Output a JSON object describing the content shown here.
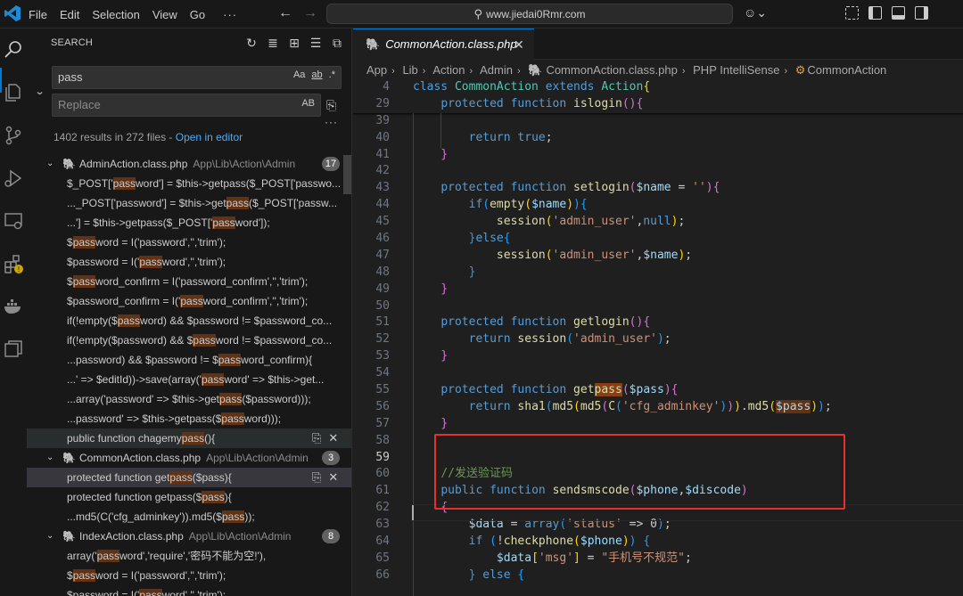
{
  "titlebar": {
    "menus": [
      "File",
      "Edit",
      "Selection",
      "View",
      "Go"
    ],
    "more": "···",
    "address": "www.jiedai0Rmr.com"
  },
  "sidebar": {
    "title": "SEARCH",
    "search_value": "pass",
    "replace_placeholder": "Replace",
    "opt_case": "Aa",
    "opt_word": "ab",
    "opt_regex": ".*",
    "opt_preserve": "AB",
    "summary": "1402 results in 272 files - ",
    "open_in_editor": "Open in editor",
    "results": [
      {
        "kind": "file",
        "name": "AdminAction.class.php",
        "path": "App\\Lib\\Action\\Admin",
        "count": "17"
      },
      {
        "kind": "match",
        "pre": "$_POST['",
        "hit": "pass",
        "post": "word'] = $this->getpass($_POST['passwo..."
      },
      {
        "kind": "match",
        "pre": "..._POST['password'] = $this->get",
        "hit": "pass",
        "post": "($_POST['passw..."
      },
      {
        "kind": "match",
        "pre": "...'] = $this->getpass($_POST['",
        "hit": "pass",
        "post": "word']);"
      },
      {
        "kind": "match",
        "pre": "$",
        "hit": "pass",
        "post": "word = I('password','','trim');"
      },
      {
        "kind": "match",
        "pre": "$password = I('",
        "hit": "pass",
        "post": "word','','trim');"
      },
      {
        "kind": "match",
        "pre": "$",
        "hit": "pass",
        "post": "word_confirm = I('password_confirm','','trim');"
      },
      {
        "kind": "match",
        "pre": "$password_confirm = I('",
        "hit": "pass",
        "post": "word_confirm','','trim');"
      },
      {
        "kind": "match",
        "pre": "if(!empty($",
        "hit": "pass",
        "post": "word) && $password != $password_co..."
      },
      {
        "kind": "match",
        "pre": "if(!empty($password) && $",
        "hit": "pass",
        "post": "word != $password_co..."
      },
      {
        "kind": "match",
        "pre": "...password) && $password != $",
        "hit": "pass",
        "post": "word_confirm){"
      },
      {
        "kind": "match",
        "pre": "...' => $editId))->save(array('",
        "hit": "pass",
        "post": "word' => $this->get..."
      },
      {
        "kind": "match",
        "pre": "...array('password' => $this->get",
        "hit": "pass",
        "post": "($password)));"
      },
      {
        "kind": "match",
        "pre": "...password' => $this->getpass($",
        "hit": "pass",
        "post": "word)));"
      },
      {
        "kind": "match",
        "pre": "public function chagemy",
        "hit": "pass",
        "post": "(){",
        "focus": true
      },
      {
        "kind": "file",
        "name": "CommonAction.class.php",
        "path": "App\\Lib\\Action\\Admin",
        "count": "3"
      },
      {
        "kind": "match",
        "pre": "protected function get",
        "hit": "pass",
        "post": "($pass){",
        "selected": true
      },
      {
        "kind": "match",
        "pre": "protected function getpass($",
        "hit": "pass",
        "post": "){"
      },
      {
        "kind": "match",
        "pre": "...md5(C('cfg_adminkey')).md5($",
        "hit": "pass",
        "post": "));"
      },
      {
        "kind": "file",
        "name": "IndexAction.class.php",
        "path": "App\\Lib\\Action\\Admin",
        "count": "8"
      },
      {
        "kind": "match",
        "pre": "array('",
        "hit": "pass",
        "post": "word','require','密码不能为空!'),"
      },
      {
        "kind": "match",
        "pre": "$",
        "hit": "pass",
        "post": "word = I('password','','trim');"
      },
      {
        "kind": "match",
        "pre": "$password = I('",
        "hit": "pass",
        "post": "word','','trim');"
      }
    ]
  },
  "editor": {
    "tab_label": "CommonAction.class.php",
    "breadcrumb": [
      "App",
      "Lib",
      "Action",
      "Admin",
      "CommonAction.class.php",
      "PHP IntelliSense",
      "CommonAction"
    ],
    "sticky": [
      {
        "ln": "4",
        "html": "<span class='k'>class</span> <span class='t'>CommonAction</span> <span class='k'>extends</span> <span class='t'>Action</span><span class='b'>{</span>"
      },
      {
        "ln": "29",
        "html": "    <span class='k'>protected</span> <span class='k'>function</span> <span class='f'>islogin</span><span class='b2'>()</span><span class='b2'>{</span>"
      }
    ],
    "lines": [
      {
        "ln": "39",
        "html": ""
      },
      {
        "ln": "40",
        "html": "        <span class='k'>return</span> <span class='k'>true</span>;"
      },
      {
        "ln": "41",
        "html": "    <span class='b2'>}</span>"
      },
      {
        "ln": "42",
        "html": ""
      },
      {
        "ln": "43",
        "html": "    <span class='k'>protected</span> <span class='k'>function</span> <span class='f'>setlogin</span><span class='b2'>(</span><span class='v'>$name</span> = <span class='s'>''</span><span class='b2'>)</span><span class='b2'>{</span>"
      },
      {
        "ln": "44",
        "html": "        <span class='k'>if</span><span class='b3'>(</span><span class='f'>empty</span><span class='b'>(</span><span class='v'>$name</span><span class='b'>)</span><span class='b3'>)</span><span class='b3'>{</span>"
      },
      {
        "ln": "45",
        "html": "            <span class='f'>session</span><span class='b'>(</span><span class='s'>'admin_user'</span>,<span class='k'>null</span><span class='b'>)</span>;"
      },
      {
        "ln": "46",
        "html": "        <span class='b3'>}</span><span class='k'>else</span><span class='b3'>{</span>"
      },
      {
        "ln": "47",
        "html": "            <span class='f'>session</span><span class='b'>(</span><span class='s'>'admin_user'</span>,<span class='v'>$name</span><span class='b'>)</span>;"
      },
      {
        "ln": "48",
        "html": "        <span class='b3'>}</span>"
      },
      {
        "ln": "49",
        "html": "    <span class='b2'>}</span>"
      },
      {
        "ln": "50",
        "html": ""
      },
      {
        "ln": "51",
        "html": "    <span class='k'>protected</span> <span class='k'>function</span> <span class='f'>getlogin</span><span class='b2'>()</span><span class='b2'>{</span>"
      },
      {
        "ln": "52",
        "html": "        <span class='k'>return</span> <span class='f'>session</span><span class='b3'>(</span><span class='s'>'admin_user'</span><span class='b3'>)</span>;"
      },
      {
        "ln": "53",
        "html": "    <span class='b2'>}</span>"
      },
      {
        "ln": "54",
        "html": ""
      },
      {
        "ln": "55",
        "html": "    <span class='k'>protected</span> <span class='k'>function</span> <span class='f'>get</span><mark class='hs'><span class='f'>pass</span></mark><span class='b2'>(</span><span class='v'>$pass</span><span class='b2'>)</span><span class='b2'>{</span>"
      },
      {
        "ln": "56",
        "html": "        <span class='k'>return</span> <span class='f'>sha1</span><span class='b3'>(</span><span class='f'>md5</span><span class='b'>(</span><span class='f'>md5</span><span class='b2'>(</span><span class='f'>C</span><span class='b3'>(</span><span class='s'>'cfg_adminkey'</span><span class='b3'>)</span><span class='b2'>)</span><span class='b'>)</span>.<span class='f'>md5</span><span class='b'>(</span><mark class='h'><span class='v'>$pass</span></mark><span class='b'>)</span><span class='b3'>)</span>;"
      },
      {
        "ln": "57",
        "html": "    <span class='b2'>}</span>"
      },
      {
        "ln": "58",
        "html": ""
      },
      {
        "ln": "59",
        "html": "",
        "current": true
      },
      {
        "ln": "60",
        "html": "    <span class='c'>//发送验证码</span>"
      },
      {
        "ln": "61",
        "html": "    <span class='k'>public</span> <span class='k'>function</span> <span class='f'>sendsmscode</span><span class='b2'>(</span><span class='v'>$phone</span>,<span class='v'>$discode</span><span class='b2'>)</span>"
      },
      {
        "ln": "62",
        "html": "    <span class='b2'>{</span>"
      },
      {
        "ln": "63",
        "html": "        <span class='v'>$data</span> = <span class='k'>array</span><span class='b3'>(</span><span class='s'>'status'</span> => <span class='w'>0</span><span class='b3'>)</span>;"
      },
      {
        "ln": "64",
        "html": "        <span class='k'>if</span> <span class='b3'>(</span>!<span class='f'>checkphone</span><span class='b'>(</span><span class='v'>$phone</span><span class='b'>)</span><span class='b3'>)</span> <span class='b3'>{</span>"
      },
      {
        "ln": "65",
        "html": "            <span class='v'>$data</span><span class='b'>[</span><span class='s'>'msg'</span><span class='b'>]</span> = <span class='s'>\"手机号不规范\"</span>;"
      },
      {
        "ln": "66",
        "html": "        <span class='b3'>}</span> <span class='k'>else</span> <span class='b3'>{</span>"
      }
    ]
  }
}
